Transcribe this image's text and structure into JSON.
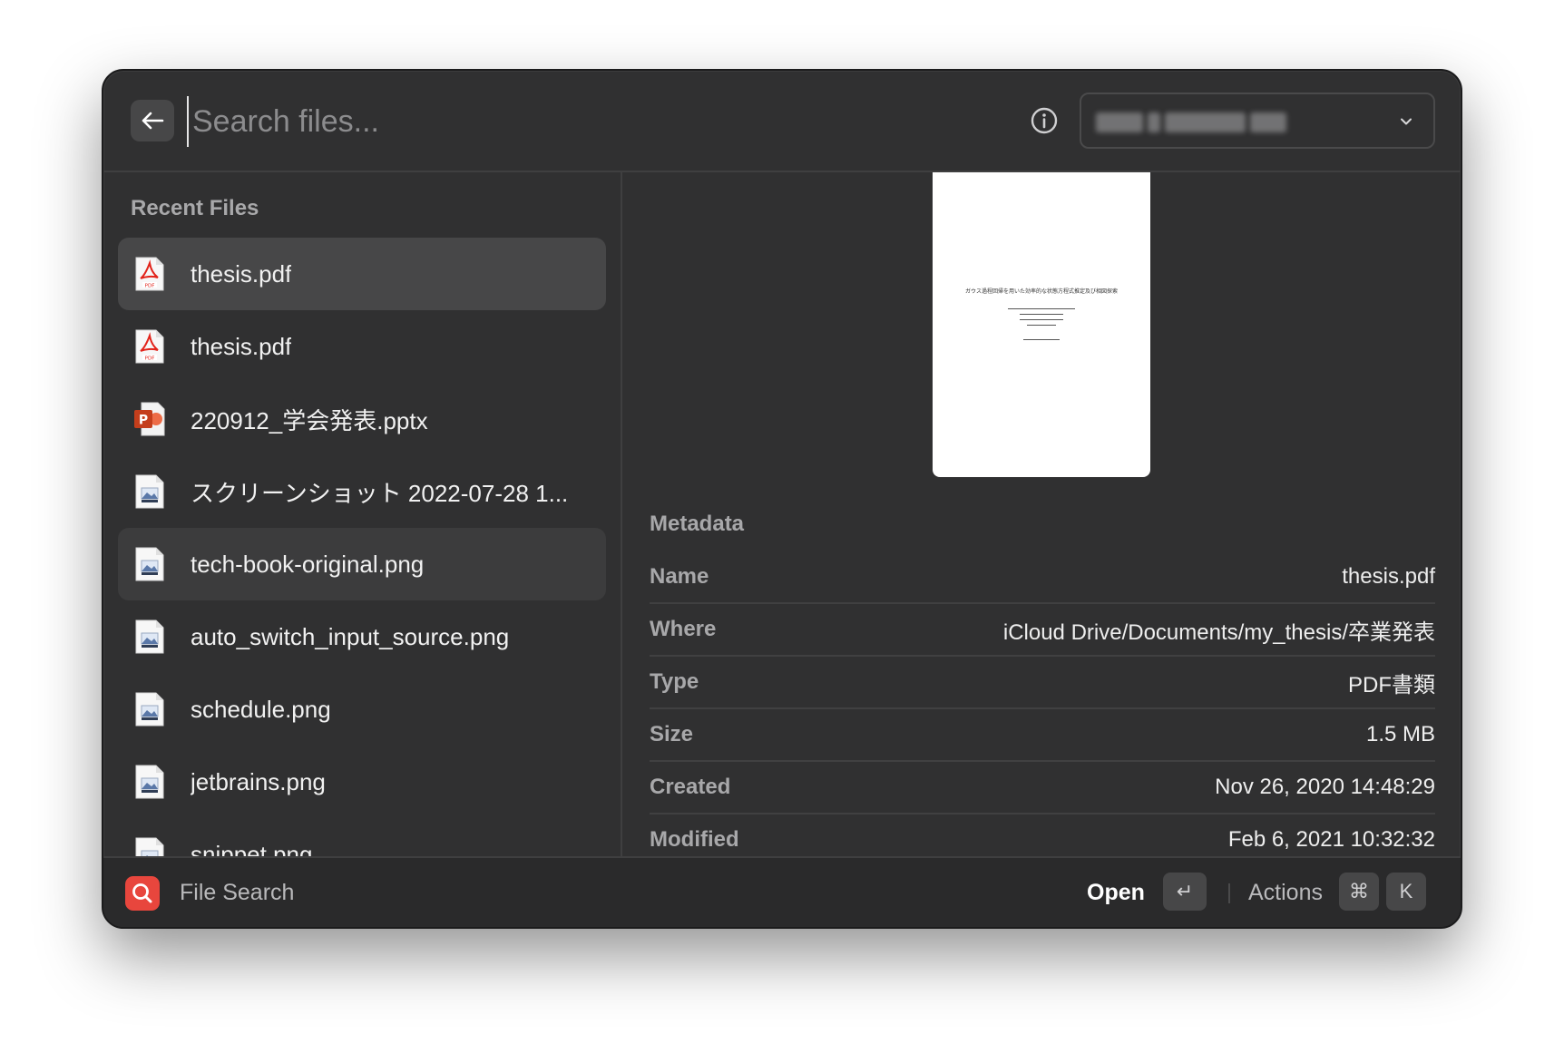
{
  "search": {
    "placeholder": "Search files..."
  },
  "left": {
    "section_title": "Recent Files",
    "files": [
      {
        "name": "thesis.pdf",
        "icon": "pdf-file-icon"
      },
      {
        "name": "thesis.pdf",
        "icon": "pdf-file-icon"
      },
      {
        "name": "220912_学会発表.pptx",
        "icon": "pptx-file-icon"
      },
      {
        "name": "スクリーンショット 2022-07-28 1...",
        "icon": "image-file-icon"
      },
      {
        "name": "tech-book-original.png",
        "icon": "image-file-icon"
      },
      {
        "name": "auto_switch_input_source.png",
        "icon": "image-file-icon"
      },
      {
        "name": "schedule.png",
        "icon": "image-file-icon"
      },
      {
        "name": "jetbrains.png",
        "icon": "image-file-icon"
      },
      {
        "name": "snippet.png",
        "icon": "image-file-icon"
      }
    ]
  },
  "preview": {
    "title_text": "ガウス過程回帰を用いた効率的な状態方程式推定及び相図探索"
  },
  "metadata": {
    "title": "Metadata",
    "rows": [
      {
        "key": "Name",
        "value": "thesis.pdf"
      },
      {
        "key": "Where",
        "value": "iCloud Drive/Documents/my_thesis/卒業発表"
      },
      {
        "key": "Type",
        "value": "PDF書類"
      },
      {
        "key": "Size",
        "value": "1.5 MB"
      },
      {
        "key": "Created",
        "value": "Nov 26, 2020 14:48:29"
      },
      {
        "key": "Modified",
        "value": "Feb 6, 2021 10:32:32"
      }
    ]
  },
  "footer": {
    "app_name": "File Search",
    "open_label": "Open",
    "return_key": "↵",
    "actions_label": "Actions",
    "cmd_key": "⌘",
    "k_key": "K"
  },
  "colors": {
    "accent": "#e8463d",
    "background": "#303031",
    "selected_row": "#474748"
  }
}
